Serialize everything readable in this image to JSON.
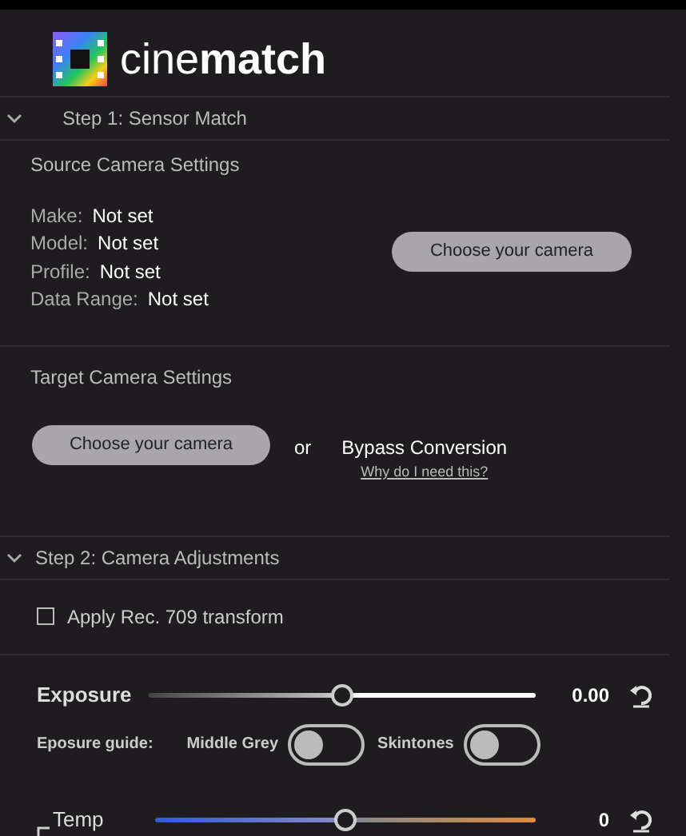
{
  "logo": {
    "text": "cine**match**"
  },
  "step1": {
    "title": "Step 1: Sensor Match",
    "expanded": true,
    "source": {
      "heading": "Source Camera Settings",
      "fields": [
        {
          "label": "Make:",
          "value": "Not set"
        },
        {
          "label": "Model:",
          "value": "Not set"
        },
        {
          "label": "Profile:",
          "value": "Not set"
        },
        {
          "label": "Data Range:",
          "value": "Not set"
        }
      ],
      "button": "Choose your camera"
    },
    "target": {
      "heading": "Target Camera Settings",
      "button": "Choose your camera",
      "or": "or",
      "bypass": "Bypass Conversion",
      "help_link": "Why do I need this?"
    }
  },
  "step2": {
    "title": "Step 2: Camera Adjustments",
    "expanded": true,
    "rec709": {
      "label": "Apply Rec. 709 transform",
      "checked": false
    },
    "sliders": [
      {
        "kind": "exposure",
        "label": "Exposure",
        "level": 0.5,
        "reading": "0.00"
      },
      {
        "kind": "temp",
        "label": "Temp",
        "level": 0.5,
        "reading": "0"
      }
    ],
    "guide": {
      "label": "Eposure guide:",
      "toggles": [
        {
          "label": "Middle Grey",
          "on": false
        },
        {
          "label": "Skintones",
          "on": false
        }
      ]
    }
  }
}
